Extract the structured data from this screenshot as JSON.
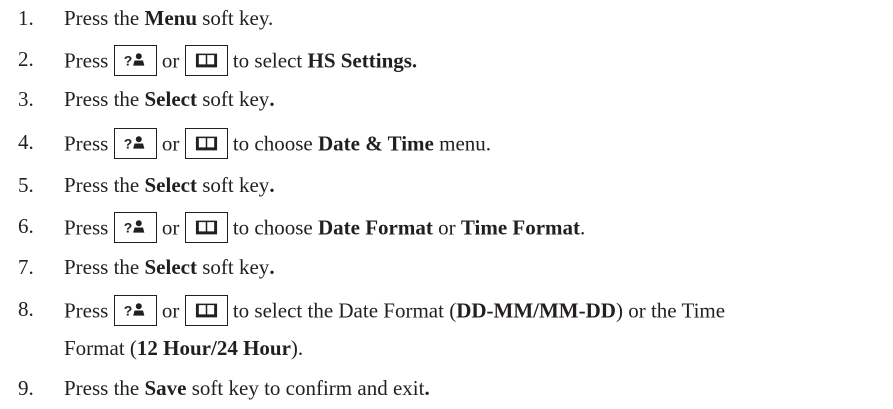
{
  "steps": [
    {
      "n": "1.",
      "parts": [
        {
          "t": "Press the "
        },
        {
          "t": "Menu",
          "b": true
        },
        {
          "t": " soft key."
        }
      ]
    },
    {
      "n": "2.",
      "parts": [
        {
          "t": "Press "
        },
        {
          "key": "person"
        },
        {
          "t": " or "
        },
        {
          "key": "book"
        },
        {
          "t": " to select "
        },
        {
          "t": "HS Settings.",
          "b": true
        }
      ]
    },
    {
      "n": "3.",
      "parts": [
        {
          "t": "Press the "
        },
        {
          "t": "Select",
          "b": true
        },
        {
          "t": " soft key"
        },
        {
          "t": ".",
          "b": true
        }
      ]
    },
    {
      "n": "4.",
      "parts": [
        {
          "t": "Press "
        },
        {
          "key": "person"
        },
        {
          "t": " or "
        },
        {
          "key": "book"
        },
        {
          "t": " to choose "
        },
        {
          "t": "Date & Time",
          "b": true
        },
        {
          "t": " menu."
        }
      ]
    },
    {
      "n": "5.",
      "parts": [
        {
          "t": "Press the "
        },
        {
          "t": "Select",
          "b": true
        },
        {
          "t": " soft key"
        },
        {
          "t": ".",
          "b": true
        }
      ]
    },
    {
      "n": "6.",
      "parts": [
        {
          "t": "Press "
        },
        {
          "key": "person"
        },
        {
          "t": " or "
        },
        {
          "key": "book"
        },
        {
          "t": " to choose "
        },
        {
          "t": "Date Format",
          "b": true
        },
        {
          "t": " or  "
        },
        {
          "t": "Time Format",
          "b": true
        },
        {
          "t": "."
        }
      ]
    },
    {
      "n": "7.",
      "parts": [
        {
          "t": "Press the "
        },
        {
          "t": "Select",
          "b": true
        },
        {
          "t": " soft key"
        },
        {
          "t": ".",
          "b": true
        }
      ]
    },
    {
      "n": "8.",
      "parts": [
        {
          "t": "Press "
        },
        {
          "key": "person"
        },
        {
          "t": " or "
        },
        {
          "key": "book"
        },
        {
          "t": " to select the Date Format ("
        },
        {
          "t": "DD-MM/MM-DD",
          "b": true
        },
        {
          "t": ") or the Time"
        }
      ],
      "cont": [
        {
          "t": "Format ("
        },
        {
          "t": "12 Hour/24 Hour",
          "b": true
        },
        {
          "t": ")."
        }
      ]
    },
    {
      "n": "9.",
      "parts": [
        {
          "t": "Press the "
        },
        {
          "t": "Save",
          "b": true
        },
        {
          "t": " soft key to confirm and exit"
        },
        {
          "t": ".",
          "b": true
        }
      ]
    }
  ]
}
